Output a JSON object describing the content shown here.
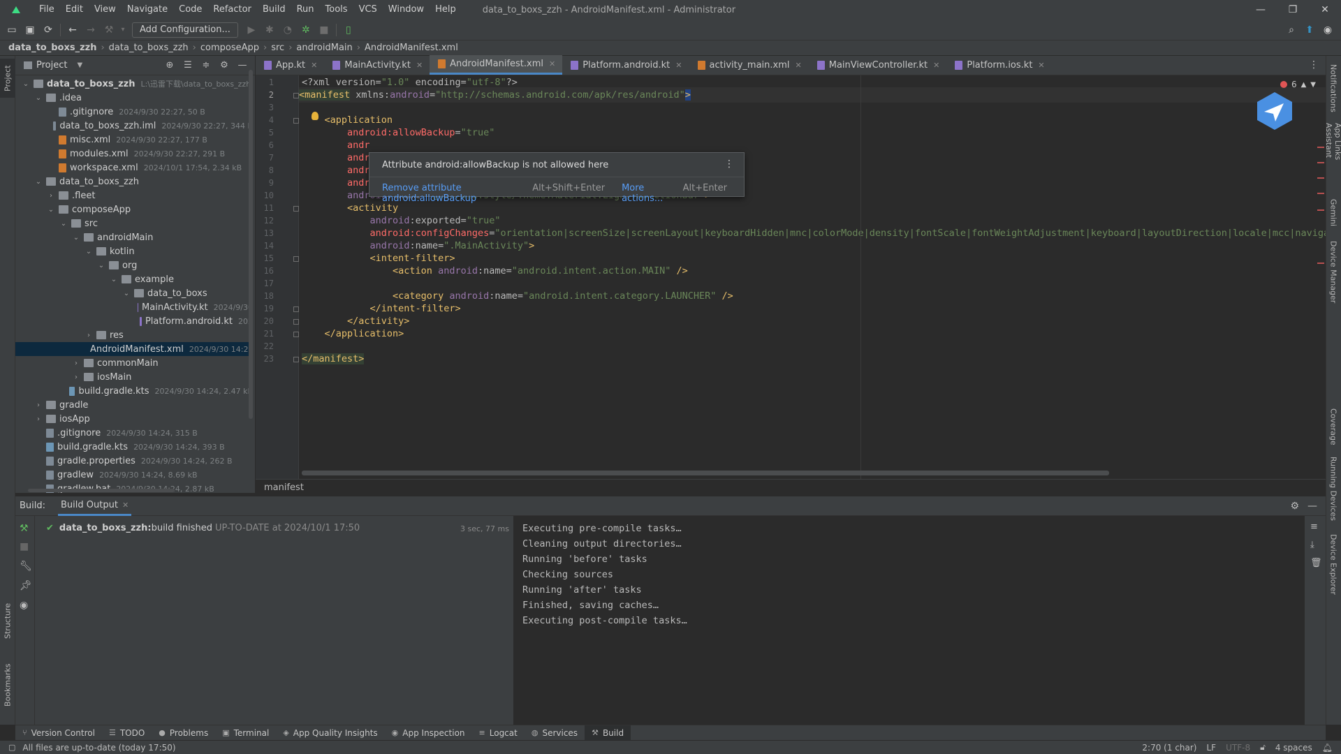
{
  "window": {
    "title": "data_to_boxs_zzh - AndroidManifest.xml - Administrator",
    "menu": [
      "File",
      "Edit",
      "View",
      "Navigate",
      "Code",
      "Refactor",
      "Build",
      "Run",
      "Tools",
      "VCS",
      "Window",
      "Help"
    ],
    "controls": {
      "minimize": "—",
      "maximize": "❐",
      "close": "✕"
    }
  },
  "toolbar": {
    "add_configuration": "Add Configuration..."
  },
  "breadcrumb": [
    "data_to_boxs_zzh",
    "data_to_boxs_zzh",
    "composeApp",
    "src",
    "androidMain",
    "AndroidManifest.xml"
  ],
  "left_strip": {
    "project": "Project",
    "structure": "Structure",
    "bookmarks": "Bookmarks"
  },
  "right_strip": [
    "Notifications",
    "App Links Assistant",
    "Gemini",
    "Device Manager",
    "Coverage",
    "Running Devices",
    "Device Explorer"
  ],
  "project_panel": {
    "title": "Project",
    "tree": [
      {
        "name": "data_to_boxs_zzh",
        "meta": "L:\\迅雷下载\\data_to_boxs_zzh",
        "arrow": "v",
        "type": "folder",
        "bold": true
      },
      {
        "name": ".idea",
        "meta": "",
        "arrow": "v",
        "type": "folder"
      },
      {
        "name": ".gitignore",
        "meta": "2024/9/30 22:27, 50 B",
        "arrow": "",
        "type": "file"
      },
      {
        "name": "data_to_boxs_zzh.iml",
        "meta": "2024/9/30 22:27, 344 B",
        "arrow": "",
        "type": "file"
      },
      {
        "name": "misc.xml",
        "meta": "2024/9/30 22:27, 177 B",
        "arrow": "",
        "type": "xml"
      },
      {
        "name": "modules.xml",
        "meta": "2024/9/30 22:27, 291 B",
        "arrow": "",
        "type": "xml"
      },
      {
        "name": "workspace.xml",
        "meta": "2024/10/1 17:54, 2.34 kB",
        "arrow": "",
        "type": "xml"
      },
      {
        "name": "data_to_boxs_zzh",
        "meta": "",
        "arrow": "v",
        "type": "folder"
      },
      {
        "name": ".fleet",
        "meta": "",
        "arrow": ">",
        "type": "folder"
      },
      {
        "name": "composeApp",
        "meta": "",
        "arrow": "v",
        "type": "folder"
      },
      {
        "name": "src",
        "meta": "",
        "arrow": "v",
        "type": "folder"
      },
      {
        "name": "androidMain",
        "meta": "",
        "arrow": "v",
        "type": "folder"
      },
      {
        "name": "kotlin",
        "meta": "",
        "arrow": "v",
        "type": "folder"
      },
      {
        "name": "org",
        "meta": "",
        "arrow": "v",
        "type": "folder"
      },
      {
        "name": "example",
        "meta": "",
        "arrow": "v",
        "type": "folder"
      },
      {
        "name": "data_to_boxs",
        "meta": "",
        "arrow": "v",
        "type": "folder"
      },
      {
        "name": "MainActivity.kt",
        "meta": "2024/9/30",
        "arrow": "",
        "type": "kt"
      },
      {
        "name": "Platform.android.kt",
        "meta": "202",
        "arrow": "",
        "type": "kt"
      },
      {
        "name": "res",
        "meta": "",
        "arrow": ">",
        "type": "folder"
      },
      {
        "name": "AndroidManifest.xml",
        "meta": "2024/9/30 14:24,",
        "arrow": "",
        "type": "xml",
        "selected": true
      },
      {
        "name": "commonMain",
        "meta": "",
        "arrow": ">",
        "type": "folder"
      },
      {
        "name": "iosMain",
        "meta": "",
        "arrow": ">",
        "type": "folder"
      },
      {
        "name": "build.gradle.kts",
        "meta": "2024/9/30 14:24, 2.47 kB",
        "arrow": "",
        "type": "gradle"
      },
      {
        "name": "gradle",
        "meta": "",
        "arrow": ">",
        "type": "folder"
      },
      {
        "name": "iosApp",
        "meta": "",
        "arrow": ">",
        "type": "folder"
      },
      {
        "name": ".gitignore",
        "meta": "2024/9/30 14:24, 315 B",
        "arrow": "",
        "type": "file"
      },
      {
        "name": "build.gradle.kts",
        "meta": "2024/9/30 14:24, 393 B",
        "arrow": "",
        "type": "gradle"
      },
      {
        "name": "gradle.properties",
        "meta": "2024/9/30 14:24, 262 B",
        "arrow": "",
        "type": "file"
      },
      {
        "name": "gradlew",
        "meta": "2024/9/30 14:24, 8.69 kB",
        "arrow": "",
        "type": "file"
      },
      {
        "name": "gradlew.bat",
        "meta": "2024/9/30 14:24, 2.87 kB",
        "arrow": "",
        "type": "file"
      }
    ]
  },
  "tabs": [
    {
      "label": "App.kt",
      "type": "kt",
      "active": false
    },
    {
      "label": "MainActivity.kt",
      "type": "kt",
      "active": false
    },
    {
      "label": "AndroidManifest.xml",
      "type": "xml",
      "active": true
    },
    {
      "label": "Platform.android.kt",
      "type": "kt",
      "active": false
    },
    {
      "label": "activity_main.xml",
      "type": "xml",
      "active": false
    },
    {
      "label": "MainViewController.kt",
      "type": "kt",
      "active": false
    },
    {
      "label": "Platform.ios.kt",
      "type": "kt",
      "active": false
    }
  ],
  "editor": {
    "error_count": "6",
    "current_line": 2,
    "lines": [
      [
        {
          "t": "<?xml version=",
          "c": "c-attr"
        },
        {
          "t": "\"1.0\"",
          "c": "c-str"
        },
        {
          "t": " encoding=",
          "c": "c-attr"
        },
        {
          "t": "\"utf-8\"",
          "c": "c-str"
        },
        {
          "t": "?>",
          "c": "c-attr"
        }
      ],
      [
        {
          "t": "<manifest",
          "c": "c-tag c-hl"
        },
        {
          "t": " xmlns:",
          "c": "c-attr"
        },
        {
          "t": "android",
          "c": "c-ns"
        },
        {
          "t": "=",
          "c": "c-attr"
        },
        {
          "t": "\"http://schemas.android.com/apk/res/android\"",
          "c": "c-str"
        },
        {
          "t": ">",
          "c": "c-tag c-hlsel"
        }
      ],
      [],
      [
        {
          "t": "    <application",
          "c": "c-tag"
        }
      ],
      [
        {
          "t": "        ",
          "c": ""
        },
        {
          "t": "android:allowBackup",
          "c": "c-err"
        },
        {
          "t": "=",
          "c": "c-attr"
        },
        {
          "t": "\"true\"",
          "c": "c-str"
        }
      ],
      [
        {
          "t": "        ",
          "c": ""
        },
        {
          "t": "andr",
          "c": "c-err"
        }
      ],
      [
        {
          "t": "        ",
          "c": ""
        },
        {
          "t": "andr",
          "c": "c-err"
        }
      ],
      [
        {
          "t": "        ",
          "c": ""
        },
        {
          "t": "andr",
          "c": "c-err"
        }
      ],
      [
        {
          "t": "        ",
          "c": ""
        },
        {
          "t": "android:supportsRtl",
          "c": "c-err"
        },
        {
          "t": "=",
          "c": "c-attr"
        },
        {
          "t": "\"true\"",
          "c": "c-str"
        }
      ],
      [
        {
          "t": "        ",
          "c": ""
        },
        {
          "t": "android",
          "c": "c-ns"
        },
        {
          "t": ":theme=",
          "c": "c-attr"
        },
        {
          "t": "\"@android:style/Theme.Material.Light.NoActionBar\"",
          "c": "c-str"
        },
        {
          "t": ">",
          "c": "c-tag"
        }
      ],
      [
        {
          "t": "        <activity",
          "c": "c-tag"
        }
      ],
      [
        {
          "t": "            ",
          "c": ""
        },
        {
          "t": "android",
          "c": "c-ns"
        },
        {
          "t": ":exported=",
          "c": "c-attr"
        },
        {
          "t": "\"true\"",
          "c": "c-str"
        }
      ],
      [
        {
          "t": "            ",
          "c": ""
        },
        {
          "t": "android:configChanges",
          "c": "c-err"
        },
        {
          "t": "=",
          "c": "c-attr"
        },
        {
          "t": "\"orientation|screenSize|screenLayout|keyboardHidden|mnc|colorMode|density|fontScale|fontWeightAdjustment|keyboard|layoutDirection|locale|mcc|navigati",
          "c": "c-str"
        }
      ],
      [
        {
          "t": "            ",
          "c": ""
        },
        {
          "t": "android",
          "c": "c-ns"
        },
        {
          "t": ":name=",
          "c": "c-attr"
        },
        {
          "t": "\".MainActivity\"",
          "c": "c-str"
        },
        {
          "t": ">",
          "c": "c-tag"
        }
      ],
      [
        {
          "t": "            <intent-filter>",
          "c": "c-tag"
        }
      ],
      [
        {
          "t": "                <action ",
          "c": "c-tag"
        },
        {
          "t": "android",
          "c": "c-ns"
        },
        {
          "t": ":name=",
          "c": "c-attr"
        },
        {
          "t": "\"android.intent.action.MAIN\"",
          "c": "c-str"
        },
        {
          "t": " />",
          "c": "c-tag"
        }
      ],
      [],
      [
        {
          "t": "                <category ",
          "c": "c-tag"
        },
        {
          "t": "android",
          "c": "c-ns"
        },
        {
          "t": ":name=",
          "c": "c-attr"
        },
        {
          "t": "\"android.intent.category.LAUNCHER\"",
          "c": "c-str"
        },
        {
          "t": " />",
          "c": "c-tag"
        }
      ],
      [
        {
          "t": "            </intent-filter>",
          "c": "c-tag"
        }
      ],
      [
        {
          "t": "        </activity>",
          "c": "c-tag"
        }
      ],
      [
        {
          "t": "    </application>",
          "c": "c-tag"
        }
      ],
      [],
      [
        {
          "t": "</manifest>",
          "c": "c-tag c-hl"
        }
      ]
    ],
    "breadcrumb": "manifest"
  },
  "popup": {
    "message": "Attribute android:allowBackup is not allowed here",
    "action_label": "Remove attribute android:allowBackup",
    "action_key": "Alt+Shift+Enter",
    "more_label": "More actions...",
    "more_key": "Alt+Enter"
  },
  "build": {
    "label": "Build:",
    "tab": "Build Output",
    "result_name": "data_to_boxs_zzh:",
    "result_text": " build finished",
    "result_meta": "UP-TO-DATE at 2024/10/1 17:50",
    "duration": "3 sec, 77 ms",
    "output": [
      "Executing pre-compile tasks…",
      "Cleaning output directories…",
      "Running 'before' tasks",
      "Checking sources",
      "Running 'after' tasks",
      "Finished, saving caches…",
      "Executing post-compile tasks…"
    ]
  },
  "tool_windows": [
    {
      "label": "Version Control",
      "icon": "⑂",
      "active": false
    },
    {
      "label": "TODO",
      "icon": "☰",
      "active": false
    },
    {
      "label": "Problems",
      "icon": "●",
      "active": false
    },
    {
      "label": "Terminal",
      "icon": "▣",
      "active": false
    },
    {
      "label": "App Quality Insights",
      "icon": "◈",
      "active": false
    },
    {
      "label": "App Inspection",
      "icon": "◉",
      "active": false
    },
    {
      "label": "Logcat",
      "icon": "≡",
      "active": false
    },
    {
      "label": "Services",
      "icon": "◍",
      "active": false
    },
    {
      "label": "Build",
      "icon": "⚒",
      "active": true
    }
  ],
  "status": {
    "message": "All files are up-to-date (today 17:50)",
    "position": "2:70 (1 char)",
    "line_sep": "LF",
    "encoding": "UTF-8",
    "indent": "4 spaces"
  },
  "colors": {
    "accent": "#4a88c7",
    "error": "#ff6b68",
    "string": "#6a8759",
    "tag": "#e8bf6a",
    "namespace": "#9876aa"
  }
}
